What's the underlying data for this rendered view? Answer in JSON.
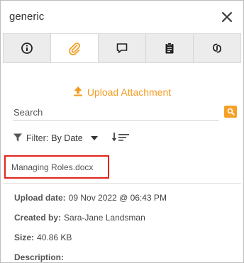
{
  "panel": {
    "title": "generic"
  },
  "tabs": [
    {
      "icon": "info-icon",
      "active": false
    },
    {
      "icon": "paperclip-icon",
      "active": true
    },
    {
      "icon": "comment-icon",
      "active": false
    },
    {
      "icon": "clipboard-icon",
      "active": false
    },
    {
      "icon": "link-icon",
      "active": false
    }
  ],
  "upload": {
    "label": "Upload Attachment",
    "icon": "upload-icon",
    "color": "#f39c22"
  },
  "search": {
    "placeholder": "Search",
    "value": "",
    "button_color": "#f5a026"
  },
  "filter": {
    "label": "Filter:",
    "value": "By Date"
  },
  "attachment": {
    "name": "Managing Roles.docx",
    "highlight_color": "#e0251b"
  },
  "details": {
    "upload_date_label": "Upload date:",
    "upload_date": "09 Nov 2022 @ 06:43 PM",
    "created_by_label": "Created by:",
    "created_by": "Sara-Jane Landsman",
    "size_label": "Size:",
    "size": "40.86 KB",
    "description_label": "Description:",
    "description": ""
  }
}
